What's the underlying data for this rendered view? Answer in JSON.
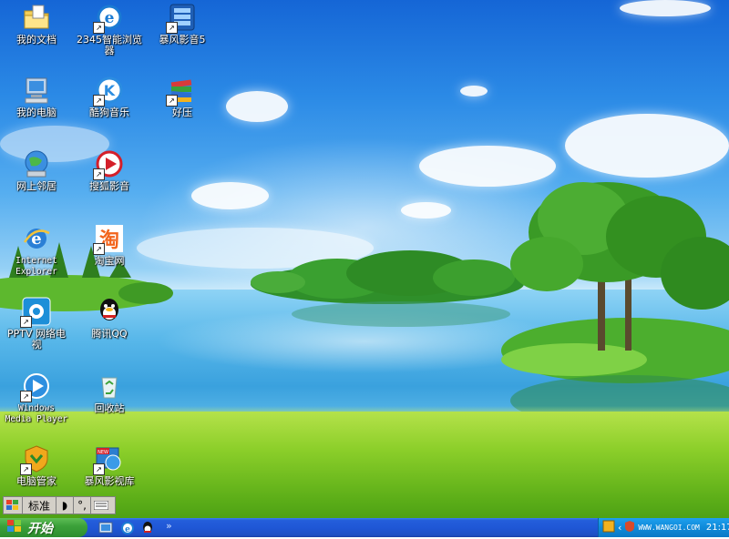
{
  "desktop": {
    "icons": [
      {
        "label": "我的文档"
      },
      {
        "label": "2345智能浏览\n器"
      },
      {
        "label": "暴风影音5"
      },
      {
        "label": "我的电脑"
      },
      {
        "label": "酷狗音乐"
      },
      {
        "label": "好压"
      },
      {
        "label": "网上邻居"
      },
      {
        "label": "搜狐影音"
      },
      {
        "label": "Internet\nExplorer"
      },
      {
        "label": "淘宝网"
      },
      {
        "label": "PPTV 网络电\n视"
      },
      {
        "label": "腾讯QQ"
      },
      {
        "label": "Windows\nMedia Player"
      },
      {
        "label": "回收站"
      },
      {
        "label": "电脑管家"
      },
      {
        "label": "暴风影视库"
      }
    ]
  },
  "ime_bar": {
    "mode": "标准"
  },
  "taskbar": {
    "start_label": "开始",
    "tray_url": "WWW.WANGOI.COM",
    "clock": "21:17"
  },
  "icon_names": [
    "folder-icon",
    "browser-icon",
    "video-player-icon",
    "computer-icon",
    "music-icon",
    "archive-icon",
    "network-icon",
    "sohu-video-icon",
    "ie-icon",
    "taobao-icon",
    "pptv-icon",
    "qq-icon",
    "media-player-icon",
    "recycle-bin-icon",
    "security-icon",
    "video-library-icon"
  ]
}
